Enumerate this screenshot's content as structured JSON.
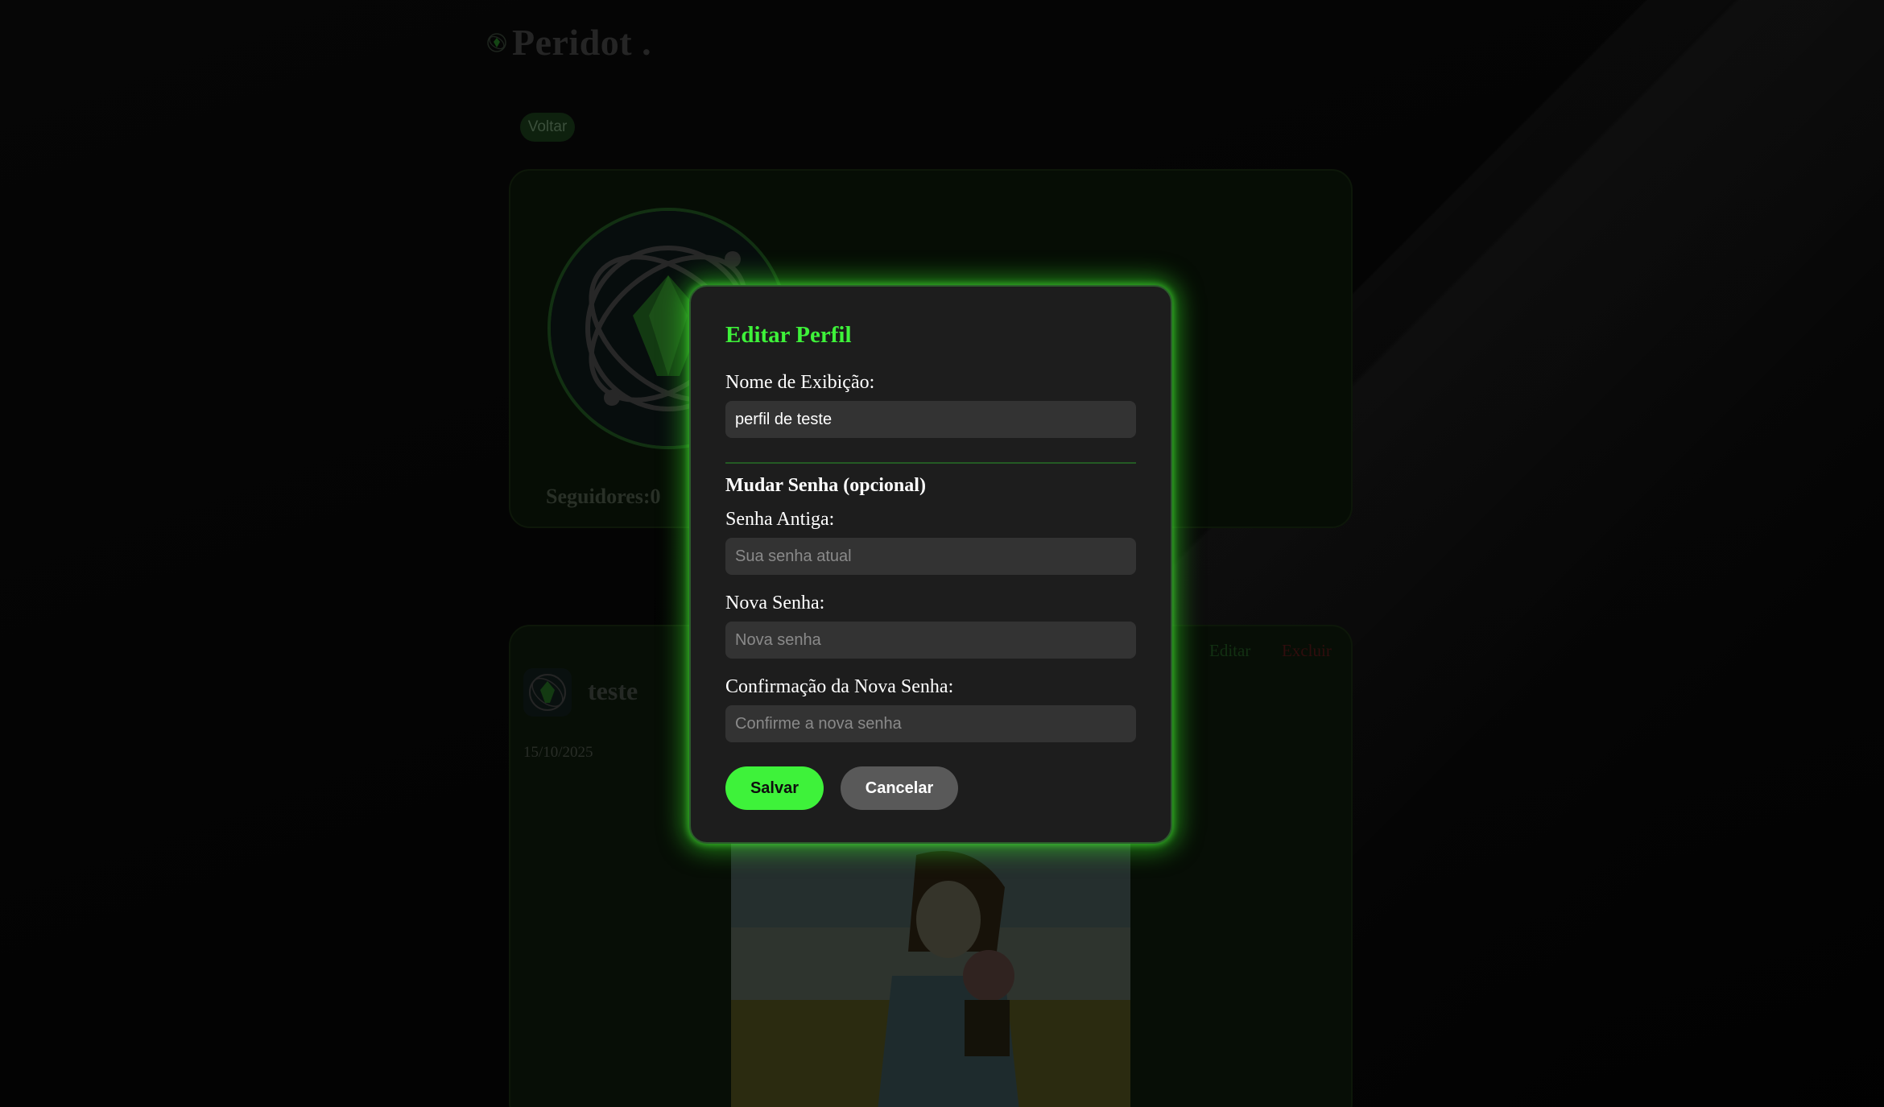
{
  "brand": {
    "name": "Peridot .",
    "logo_icon": "peridot-logo-icon"
  },
  "nav": {
    "back_label": "Voltar"
  },
  "profile": {
    "followers_label": "Seguidores:",
    "followers_count": "0",
    "avatar_icon": "peridot-gem-icon"
  },
  "post": {
    "author": "teste",
    "date": "15/10/2025",
    "edit_label": "Editar",
    "delete_label": "Excluir"
  },
  "modal": {
    "title": "Editar Perfil",
    "display_name": {
      "label": "Nome de Exibição:",
      "value": "perfil de teste"
    },
    "password_section_title": "Mudar Senha (opcional)",
    "old_password": {
      "label": "Senha Antiga:",
      "placeholder": "Sua senha atual"
    },
    "new_password": {
      "label": "Nova Senha:",
      "placeholder": "Nova senha"
    },
    "confirm_password": {
      "label": "Confirmação da Nova Senha:",
      "placeholder": "Confirme a nova senha"
    },
    "save_label": "Salvar",
    "cancel_label": "Cancelar"
  },
  "colors": {
    "accent": "#3ef23a",
    "modal_bg": "#1d1d1d",
    "input_bg": "#333333",
    "cancel_bg": "#595959",
    "delete": "#4a1414"
  }
}
